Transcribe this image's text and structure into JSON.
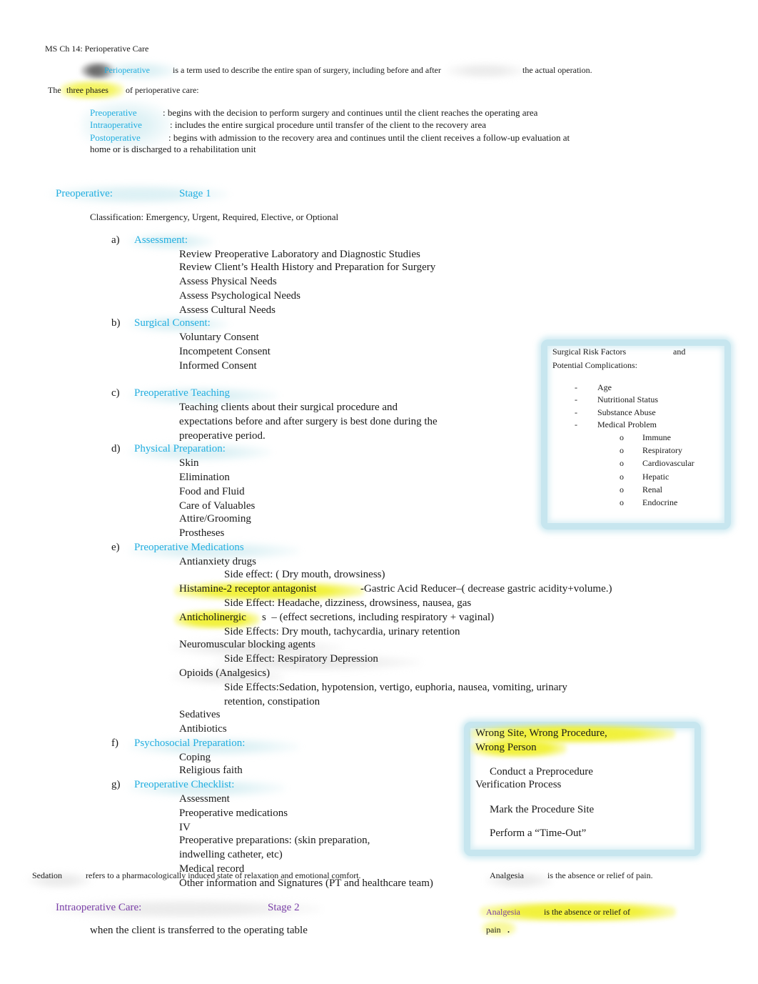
{
  "document": {
    "title": "MS Ch 14: Perioperative Care",
    "intro": {
      "term": "Perioperative",
      "definition_before": "is a term used to describe the entire span of surgery, including before and after",
      "definition_after": "the actual operation."
    },
    "phases_intro": {
      "lead": "The",
      "highlight": "three phases",
      "tail": "of perioperative care:"
    },
    "phases": [
      {
        "term": "Preoperative",
        "desc": ": begins with the decision to perform surgery and continues until the client reaches the operating area"
      },
      {
        "term": "Intraoperative",
        "desc": ": includes the entire surgical procedure until transfer of the client to the recovery area"
      },
      {
        "term": "Postoperative",
        "desc": ": begins with admission to the recovery area and continues until the client receives a follow-up evaluation at",
        "desc_line2": "home or is discharged to a rehabilitation unit"
      }
    ],
    "stage1": {
      "heading": "Preoperative:",
      "stage": "Stage 1",
      "classification": "Classification: Emergency, Urgent, Required, Elective, or Optional",
      "sections": {
        "a": {
          "marker": "a)",
          "title": "Assessment:",
          "items": [
            "Review Preoperative Laboratory and Diagnostic Studies",
            "Review Client’s Health History and Preparation for Surgery",
            "Assess Physical Needs",
            "Assess Psychological Needs",
            "Assess Cultural Needs"
          ]
        },
        "b": {
          "marker": "b)",
          "title": "Surgical Consent:",
          "items": [
            "Voluntary Consent",
            "Incompetent Consent",
            "Informed Consent"
          ]
        },
        "c": {
          "marker": "c)",
          "title": "Preoperative Teaching",
          "items": [
            "Teaching clients about their surgical procedure and",
            "expectations before and after surgery is best done during the",
            "preoperative period."
          ]
        },
        "d": {
          "marker": "d)",
          "title": "Physical Preparation:",
          "items": [
            "Skin",
            "Elimination",
            "Food and Fluid",
            "Care of Valuables",
            "Attire/Grooming",
            "Prostheses"
          ]
        },
        "e": {
          "marker": "e)",
          "title": "Preoperative Medications",
          "meds": [
            {
              "name": "Antianxiety drugs",
              "side": "Side effect: ( Dry mouth, drowsiness)"
            },
            {
              "name": "Histamine-2 receptor antagonist",
              "suffix": "-Gastric Acid Reducer–( decrease gastric acidity+volume.)",
              "side": "Side Effect: Headache, dizziness, drowsiness, nausea, gas"
            },
            {
              "name": "Anticholinergic",
              "suffix": "s  – (effect secretions, including respiratory + vaginal)",
              "side": "Side Effects: Dry mouth, tachycardia, urinary retention"
            },
            {
              "name": "Neuromuscular blocking agents",
              "side": "Side Effect: Respiratory Depression"
            },
            {
              "name": "Opioids (Analgesics)",
              "side": "Side Effects:Sedation, hypotension, vertigo, euphoria, nausea, vomiting, urinary",
              "side_line2": "retention, constipation"
            },
            {
              "name": "Sedatives"
            },
            {
              "name": "Antibiotics"
            }
          ]
        },
        "f": {
          "marker": "f)",
          "title": "Psychosocial Preparation:",
          "items": [
            "Coping",
            "Religious faith"
          ]
        },
        "g": {
          "marker": "g)",
          "title": "Preoperative Checklist:",
          "items": [
            "Assessment",
            "Preoperative medications",
            "IV",
            "Preoperative preparations: (skin preparation,",
            "indwelling catheter, etc)",
            "Medical record",
            "Other information and Signatures (PT and healthcare team)"
          ]
        }
      }
    },
    "risk_box": {
      "title_a": "Surgical Risk Factors",
      "title_and": "and",
      "title_b": "Potential Complications:",
      "dash": "-",
      "circle": "o",
      "factors": [
        "Age",
        "Nutritional Status",
        "Substance Abuse",
        "Medical Problem"
      ],
      "medical_problems": [
        "Immune",
        "Respiratory",
        "Cardiovascular",
        "Hepatic",
        "Renal",
        "Endocrine"
      ]
    },
    "wrong_box": {
      "title_line1": "Wrong Site, Wrong Procedure,",
      "title_line2": "Wrong Person",
      "items": [
        "Conduct a Preprocedure",
        "Verification Process",
        "Mark the Procedure Site",
        "Perform a “Time-Out”"
      ]
    },
    "sedation": {
      "term": "Sedation",
      "definition": "refers to a pharmacologically induced state of relaxation and emotional comfort."
    },
    "analgesia_note": {
      "term": "Analgesia",
      "definition": "is the absence or relief of pain."
    },
    "stage2": {
      "heading": "Intraoperative Care:",
      "stage": "Stage 2",
      "desc": "when the client is transferred to the operating table"
    },
    "analgesia_callout": {
      "term": "Analgesia",
      "definition": "is the absence or relief of",
      "line2": "pain",
      "dot": "."
    },
    "bullet_glyph": "",
    "colors": {
      "heading_cyan": "#22aee0",
      "heading_purple": "#7a3fa8",
      "highlight_yellow": "#f0f01e",
      "box_border": "#c7e6ef"
    }
  }
}
